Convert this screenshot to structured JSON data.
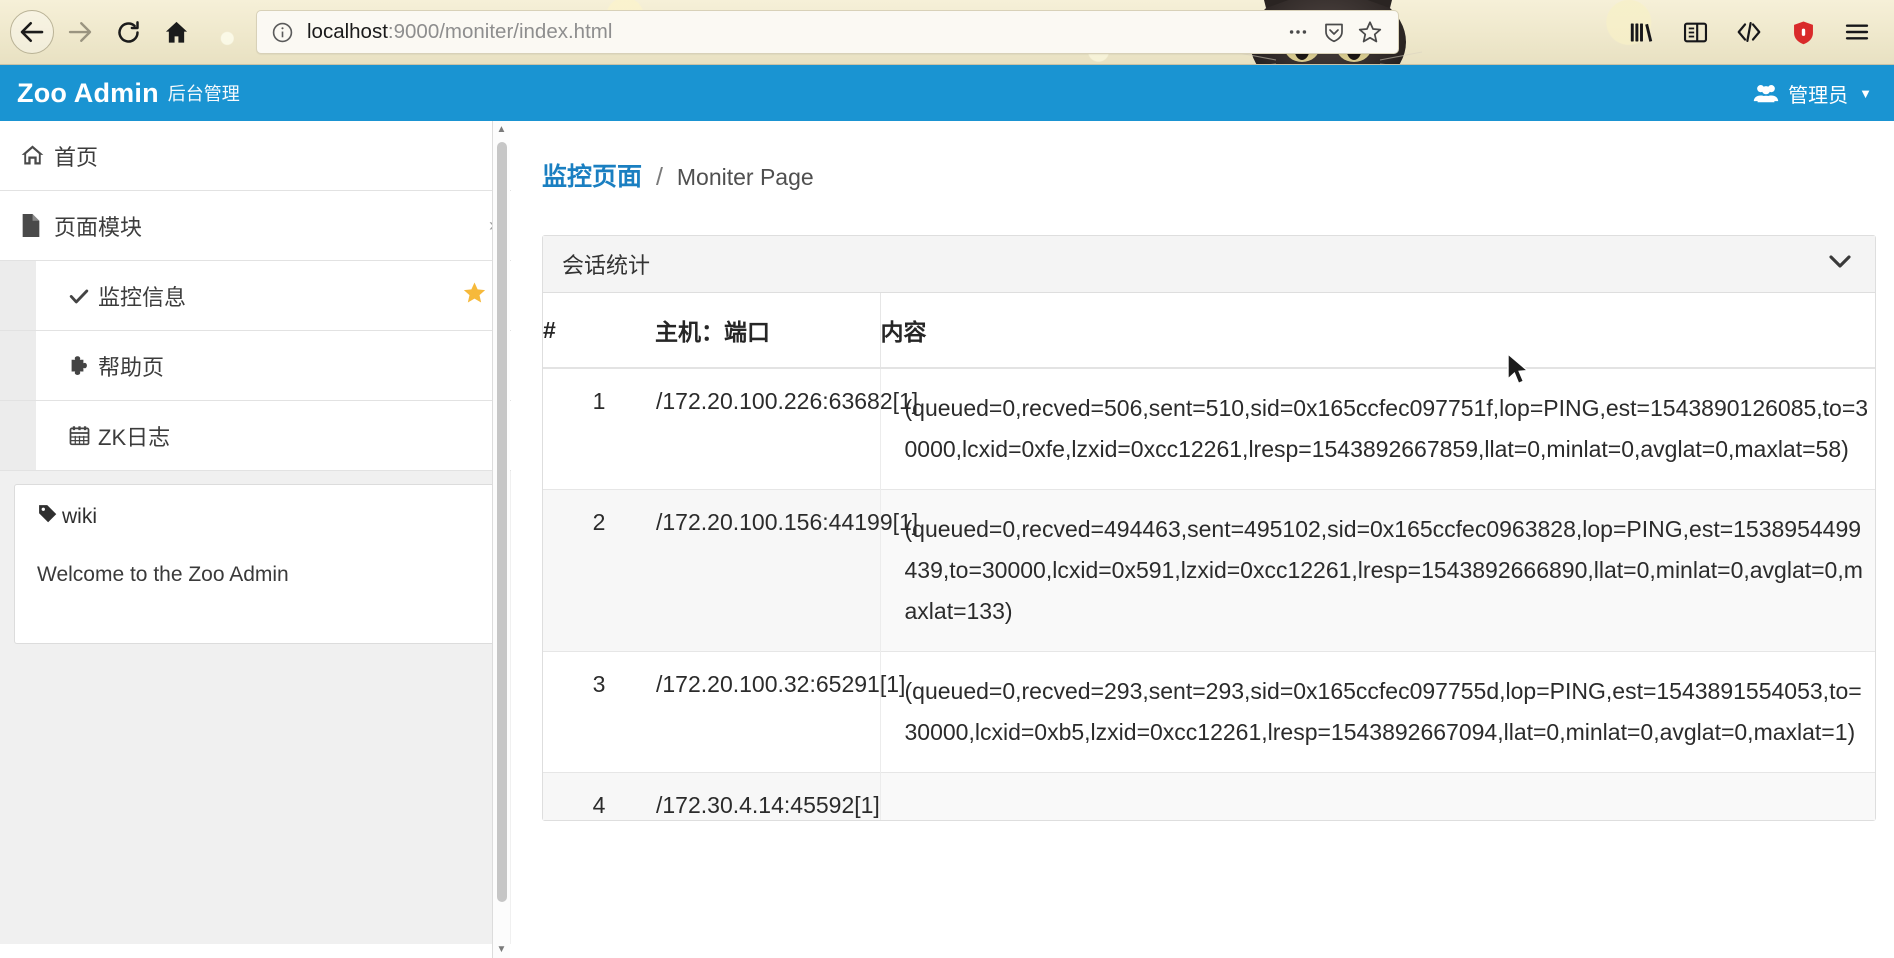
{
  "browser": {
    "nav": {
      "back_icon": "arrow-left-icon",
      "forward_icon": "arrow-right-icon",
      "reload_icon": "reload-icon",
      "home_icon": "home-icon"
    },
    "urlbar": {
      "identity_icon": "info-circle-icon",
      "host": "localhost",
      "path": ":9000/moniter/index.html",
      "full_url": "localhost:9000/moniter/index.html",
      "page_actions_icon": "ellipsis-icon",
      "pocket_icon": "pocket-shield-icon",
      "bookmark_icon": "star-outline-icon"
    },
    "toolbar_icons": [
      "library-icon",
      "sidebar-icon",
      "code-brackets-icon",
      "shield-badge-icon",
      "hamburger-menu-icon"
    ]
  },
  "app_header": {
    "brand": "Zoo Admin",
    "brand_sub": "后台管理",
    "user_icon": "users-group-icon",
    "user_label": "管理员",
    "user_caret": "▼",
    "background_color": "#1a94d2"
  },
  "sidebar": {
    "items": [
      {
        "icon": "home-icon",
        "glyph": "⌂",
        "label": "首页",
        "caret": ""
      },
      {
        "icon": "file-icon",
        "glyph": "὜E",
        "label": "页面模块",
        "caret": "›"
      }
    ],
    "sub_items": [
      {
        "icon": "check-icon",
        "glyph": "✔",
        "label": "监控信息",
        "active": true,
        "badge_icon": "star-icon",
        "badge_glyph": "★",
        "badge_color": "#f6b93b"
      },
      {
        "icon": "puzzle-icon",
        "glyph": "❖",
        "label": "帮助页",
        "active": false
      },
      {
        "icon": "calendar-icon",
        "glyph": "Ὄ5",
        "label": "ZK日志",
        "active": false
      }
    ],
    "wiki": {
      "tag_icon": "tag-icon",
      "title": "wiki",
      "body": "Welcome to the Zoo Admin"
    },
    "scrollbar": {
      "up_arrow": "▲",
      "down_arrow": "▼"
    }
  },
  "main": {
    "breadcrumb": {
      "active": "监控页面",
      "separator": "/",
      "sub": "Moniter Page"
    },
    "panel": {
      "title": "会话统计",
      "toggle_icon": "chevron-down-icon",
      "toggle_glyph": "❯"
    },
    "table": {
      "headers": [
        "#",
        "主机：端口",
        "内容"
      ],
      "rows": [
        {
          "index": "1",
          "host": "/172.20.100.226:63682[1]",
          "content": "(queued=0,recved=506,sent=510,sid=0x165ccfec097751f,lop=PING,est=1543890126085,to=30000,lcxid=0xfe,lzxid=0xcc12261,lresp=1543892667859,llat=0,minlat=0,avglat=0,maxlat=58)"
        },
        {
          "index": "2",
          "host": "/172.20.100.156:44199[1]",
          "content": "(queued=0,recved=494463,sent=495102,sid=0x165ccfec0963828,lop=PING,est=1538954499439,to=30000,lcxid=0x591,lzxid=0xcc12261,lresp=1543892666890,llat=0,minlat=0,avglat=0,maxlat=133)"
        },
        {
          "index": "3",
          "host": "/172.20.100.32:65291[1]",
          "content": "(queued=0,recved=293,sent=293,sid=0x165ccfec097755d,lop=PING,est=1543891554053,to=30000,lcxid=0xb5,lzxid=0xcc12261,lresp=1543892667094,llat=0,minlat=0,avglat=0,maxlat=1)"
        },
        {
          "index": "4",
          "host": "/172.30.4.14:45592[1]",
          "content": ""
        }
      ]
    }
  }
}
